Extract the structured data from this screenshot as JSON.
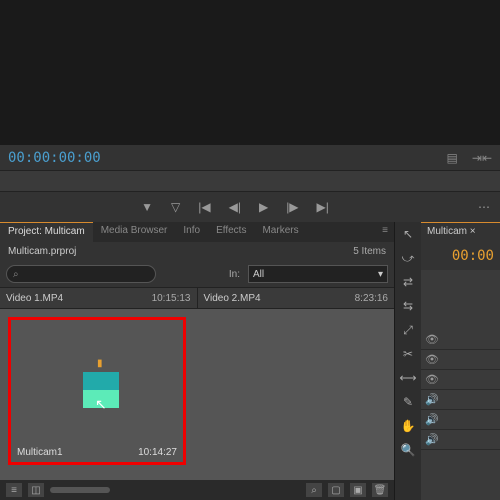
{
  "viewer": {
    "timecode": "00:00:00:00"
  },
  "tabs": {
    "project": "Project: Multicam",
    "media": "Media Browser",
    "info": "Info",
    "effects": "Effects",
    "markers": "Markers"
  },
  "project": {
    "filename": "Multicam.prproj",
    "item_count": "5 Items",
    "search_icon": "⌕",
    "in_label": "In:",
    "filter_value": "All",
    "clip1_name": "Video 1.MP4",
    "clip1_dur": "10:15:13",
    "clip2_name": "Video 2.MP4",
    "clip2_dur": "8:23:16",
    "multicam_name": "Multicam1",
    "multicam_dur": "10:14:27"
  },
  "right": {
    "tab": "Multicam ×",
    "timecode": "00:00"
  }
}
